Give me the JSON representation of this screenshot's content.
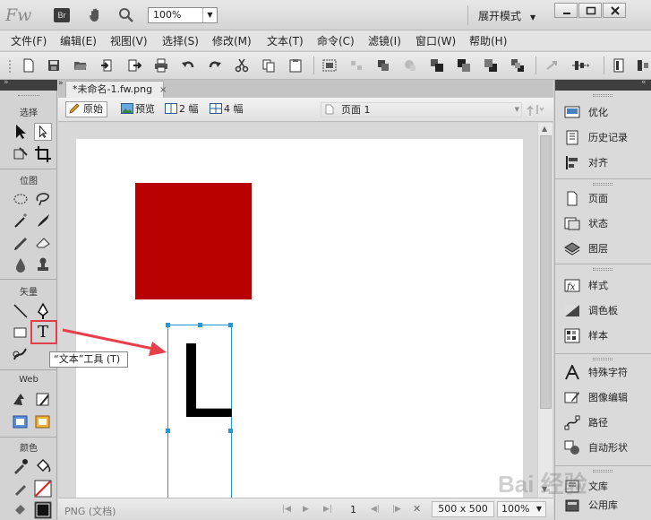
{
  "app": {
    "logo": "Fw",
    "bridge_label": "Br",
    "zoom_value": "100%",
    "workspace_label": "展开模式"
  },
  "menu": [
    "文件(F)",
    "编辑(E)",
    "视图(V)",
    "选择(S)",
    "修改(M)",
    "文本(T)",
    "命令(C)",
    "滤镜(I)",
    "窗口(W)",
    "帮助(H)"
  ],
  "tools": {
    "sections": [
      "选择",
      "位图",
      "矢量",
      "Web",
      "颜色"
    ],
    "text_tool_label": "T",
    "tooltip": "“文本”工具 (T)"
  },
  "document": {
    "tab_title": "*未命名-1.fw.png",
    "tab_close": "×",
    "views": [
      "原始",
      "预览",
      "2 幅",
      "4 幅"
    ],
    "active_view": "原始",
    "page_label": "页面 1"
  },
  "canvas": {
    "shape_color": "#b90000",
    "text_content": "L",
    "selection_color": "#1e9be0"
  },
  "status": {
    "format": "PNG (文档)",
    "page_number": "1",
    "canvas_size": "500 x 500",
    "zoom": "100%"
  },
  "panels": {
    "group1": [
      "优化",
      "历史记录",
      "对齐"
    ],
    "group2": [
      "页面",
      "状态",
      "图层"
    ],
    "group3": [
      "样式",
      "调色板",
      "样本"
    ],
    "group4": [
      "特殊字符",
      "图像编辑",
      "路径",
      "自动形状"
    ],
    "group5": [
      "文库",
      "公用库"
    ]
  },
  "watermark": "Bai 经验",
  "colors": {
    "highlight": "#e0404a",
    "arrow": "#e8404a"
  }
}
